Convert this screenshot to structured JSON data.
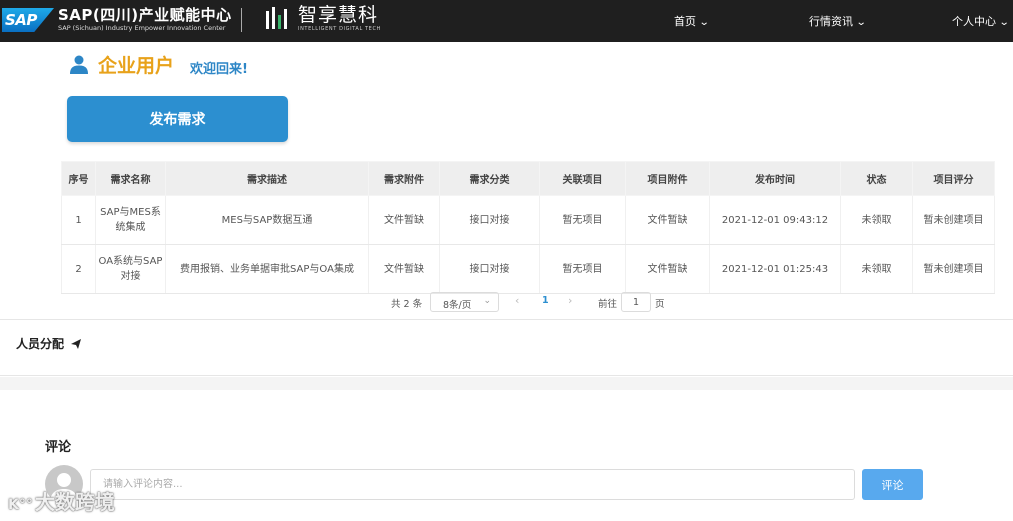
{
  "header": {
    "sap_logo_text": "SAP",
    "brand_title": "SAP(四川)产业赋能中心",
    "brand_subtitle": "SAP (Sichuan) Industry Empower Innovation Center",
    "partner_name": "智享慧科",
    "partner_subtitle": "INTELLIGENT DIGITAL TECH",
    "nav": [
      {
        "label": "首页"
      },
      {
        "label": "行情资讯"
      },
      {
        "label": "个人中心"
      }
    ],
    "bg_color": "#1f1f1f"
  },
  "profile": {
    "title": "企业用户",
    "welcome": "欢迎回来!",
    "title_color": "#e8a21a",
    "welcome_color": "#2d86c6"
  },
  "publish_button": {
    "label": "发布需求",
    "color": "#2c8fd0"
  },
  "table": {
    "headers": [
      "序号",
      "需求名称",
      "需求描述",
      "需求附件",
      "需求分类",
      "关联项目",
      "项目附件",
      "发布时间",
      "状态",
      "项目评分"
    ],
    "rows": [
      [
        "1",
        "SAP与MES系统集成",
        "MES与SAP数据互通",
        "文件暂缺",
        "接口对接",
        "暂无项目",
        "文件暂缺",
        "2021-12-01 09:43:12",
        "未领取",
        "暂未创建项目"
      ],
      [
        "2",
        "OA系统与SAP对接",
        "费用报销、业务单据审批SAP与OA集成",
        "文件暂缺",
        "接口对接",
        "暂无项目",
        "文件暂缺",
        "2021-12-01 01:25:43",
        "未领取",
        "暂未创建项目"
      ]
    ]
  },
  "pagination": {
    "total": "共 2 条",
    "page_size": "8条/页",
    "prev": "‹",
    "current_page": "1",
    "next": "›",
    "goto_label": "前往",
    "goto_value": "1",
    "page_suffix": "页"
  },
  "personnel": {
    "label": "人员分配"
  },
  "comments": {
    "title": "评论",
    "placeholder": "请输入评论内容...",
    "submit": "评论",
    "submit_color": "#58a9ee"
  },
  "watermark": {
    "mark": "K°°",
    "text": "大数跨境"
  }
}
